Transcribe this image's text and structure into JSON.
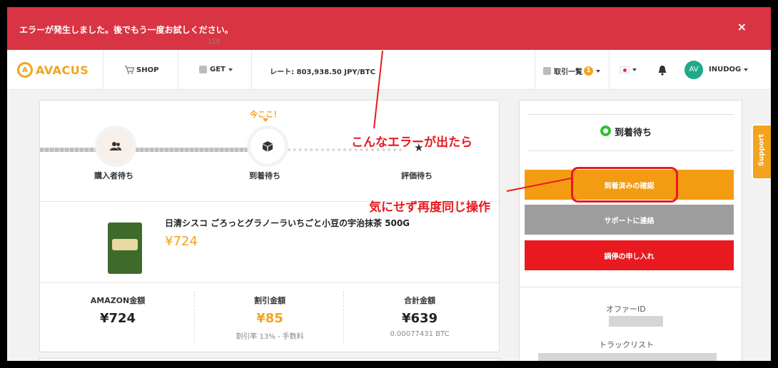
{
  "error_banner": {
    "message": "エラーが発生しました。後でもう一度お試しください。",
    "close_glyph": "×"
  },
  "navbar": {
    "logo_mark": "A",
    "logo_text": "AVACUS",
    "shop_label": "SHOP",
    "get_label": "GET",
    "get_count": "128",
    "rate_text": "レート: 803,938.50 JPY/BTC",
    "transactions_label": "取引一覧",
    "transactions_badge": "1",
    "avatar_initials": "AV",
    "username": "INUDOG"
  },
  "progress": {
    "here_label": "今ここ！",
    "steps": [
      {
        "label": "購入者待ち",
        "icon": "users-icon"
      },
      {
        "label": "到着待ち",
        "icon": "box-icon"
      },
      {
        "label": "評価待ち",
        "icon": "star-icon"
      }
    ],
    "current_step": 2
  },
  "product": {
    "name": "日清シスコ ごろっとグラノーラいちごと小豆の宇治抹茶 500G",
    "price": "¥724"
  },
  "amounts": {
    "amazon_label": "AMAZON金額",
    "amazon_value": "¥724",
    "discount_label": "割引金額",
    "discount_value": "¥85",
    "discount_sub": "割引率 13% - 手数料",
    "total_label": "合計金額",
    "total_value": "¥639",
    "total_sub": "0.00077431 BTC"
  },
  "side_panel": {
    "status": "到着待ち",
    "confirm_button": "到着済みの確認",
    "support_button": "サポートに連絡",
    "mediation_button": "調停の申し入れ",
    "offer_id_label": "オファーID",
    "track_list_label": "トラックリスト"
  },
  "support_tab": "Support",
  "annotations": {
    "error_note": "こんなエラーが出たら",
    "action_note": "気にせず再度同じ操作"
  },
  "colors": {
    "accent": "#f3a31d",
    "error": "#d93444",
    "annotation": "#e8191f",
    "status_ok": "#2ec22e"
  }
}
